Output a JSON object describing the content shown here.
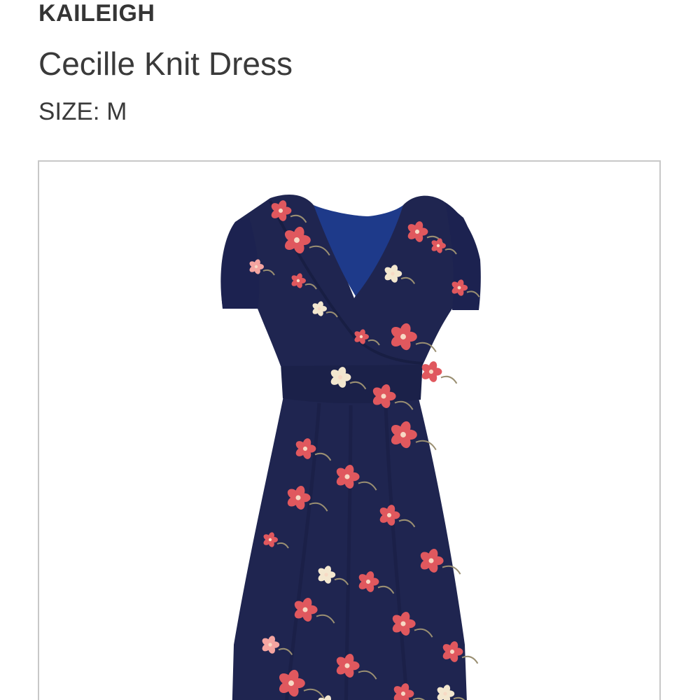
{
  "product": {
    "brand": "KAILEIGH",
    "name": "Cecille Knit Dress",
    "size_label": "SIZE: M"
  },
  "image": {
    "icon": "dress-photo",
    "colors": {
      "dress": "#1f2550",
      "dress_shadow": "#161b3d",
      "lining": "#1e3a8a",
      "flower": "#e0585e",
      "flower_light": "#f4a4a0",
      "flower_cream": "#f3e7cf",
      "leaf": "#9a8f72"
    }
  }
}
